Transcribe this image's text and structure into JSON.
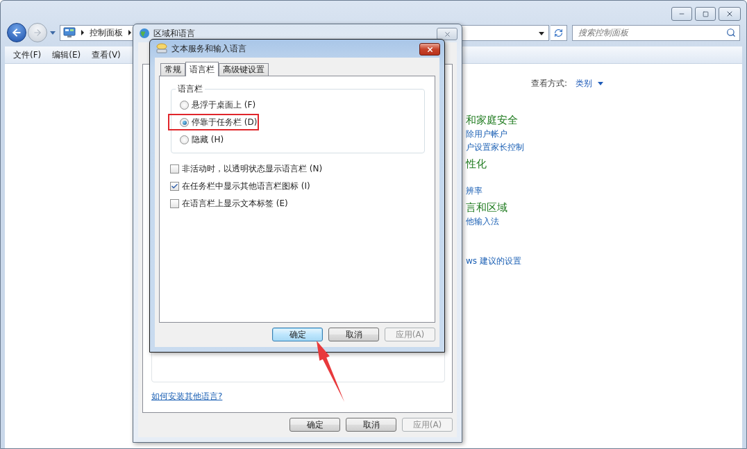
{
  "explorer": {
    "breadcrumb": [
      "控制面板"
    ],
    "search": {
      "placeholder": "搜索控制面板"
    },
    "menu": [
      "文件(F)",
      "编辑(E)",
      "查看(V)"
    ],
    "view_by": {
      "label": "查看方式:",
      "value": "类别"
    },
    "categories": [
      {
        "kind": "heading",
        "text": "和家庭安全"
      },
      {
        "kind": "link",
        "text": "除用户帐户"
      },
      {
        "kind": "link",
        "text": "户设置家长控制"
      },
      {
        "kind": "heading",
        "text": "性化"
      },
      {
        "kind": "gap"
      },
      {
        "kind": "link",
        "text": "辨率"
      },
      {
        "kind": "heading",
        "text": "言和区域"
      },
      {
        "kind": "link",
        "text": "他输入法"
      },
      {
        "kind": "gap"
      },
      {
        "kind": "gap"
      },
      {
        "kind": "link",
        "text": "ws 建议的设置"
      }
    ]
  },
  "region_dialog": {
    "title": "区域和语言",
    "link": "如何安装其他语言?",
    "buttons": [
      {
        "label": "确定",
        "default": false,
        "disabled": false
      },
      {
        "label": "取消",
        "default": false,
        "disabled": false
      },
      {
        "label": "应用(A)",
        "default": false,
        "disabled": true
      }
    ]
  },
  "text_services_dialog": {
    "title": "文本服务和输入语言",
    "tabs": [
      {
        "label": "常规",
        "selected": false
      },
      {
        "label": "语言栏",
        "selected": true
      },
      {
        "label": "高级键设置",
        "selected": false
      }
    ],
    "group_label": "语言栏",
    "radios": [
      {
        "label": "悬浮于桌面上 (F)",
        "selected": false,
        "highlighted": false
      },
      {
        "label": "停靠于任务栏 (D)",
        "selected": true,
        "highlighted": true
      },
      {
        "label": "隐藏 (H)",
        "selected": false,
        "highlighted": false
      }
    ],
    "checkboxes": [
      {
        "label": "非活动时，以透明状态显示语言栏 (N)",
        "checked": false
      },
      {
        "label": "在任务栏中显示其他语言栏图标 (I)",
        "checked": true
      },
      {
        "label": "在语言栏上显示文本标签 (E)",
        "checked": false
      }
    ],
    "buttons": [
      {
        "label": "确定",
        "default": true,
        "disabled": false
      },
      {
        "label": "取消",
        "default": false,
        "disabled": false
      },
      {
        "label": "应用(A)",
        "default": false,
        "disabled": true
      }
    ]
  }
}
